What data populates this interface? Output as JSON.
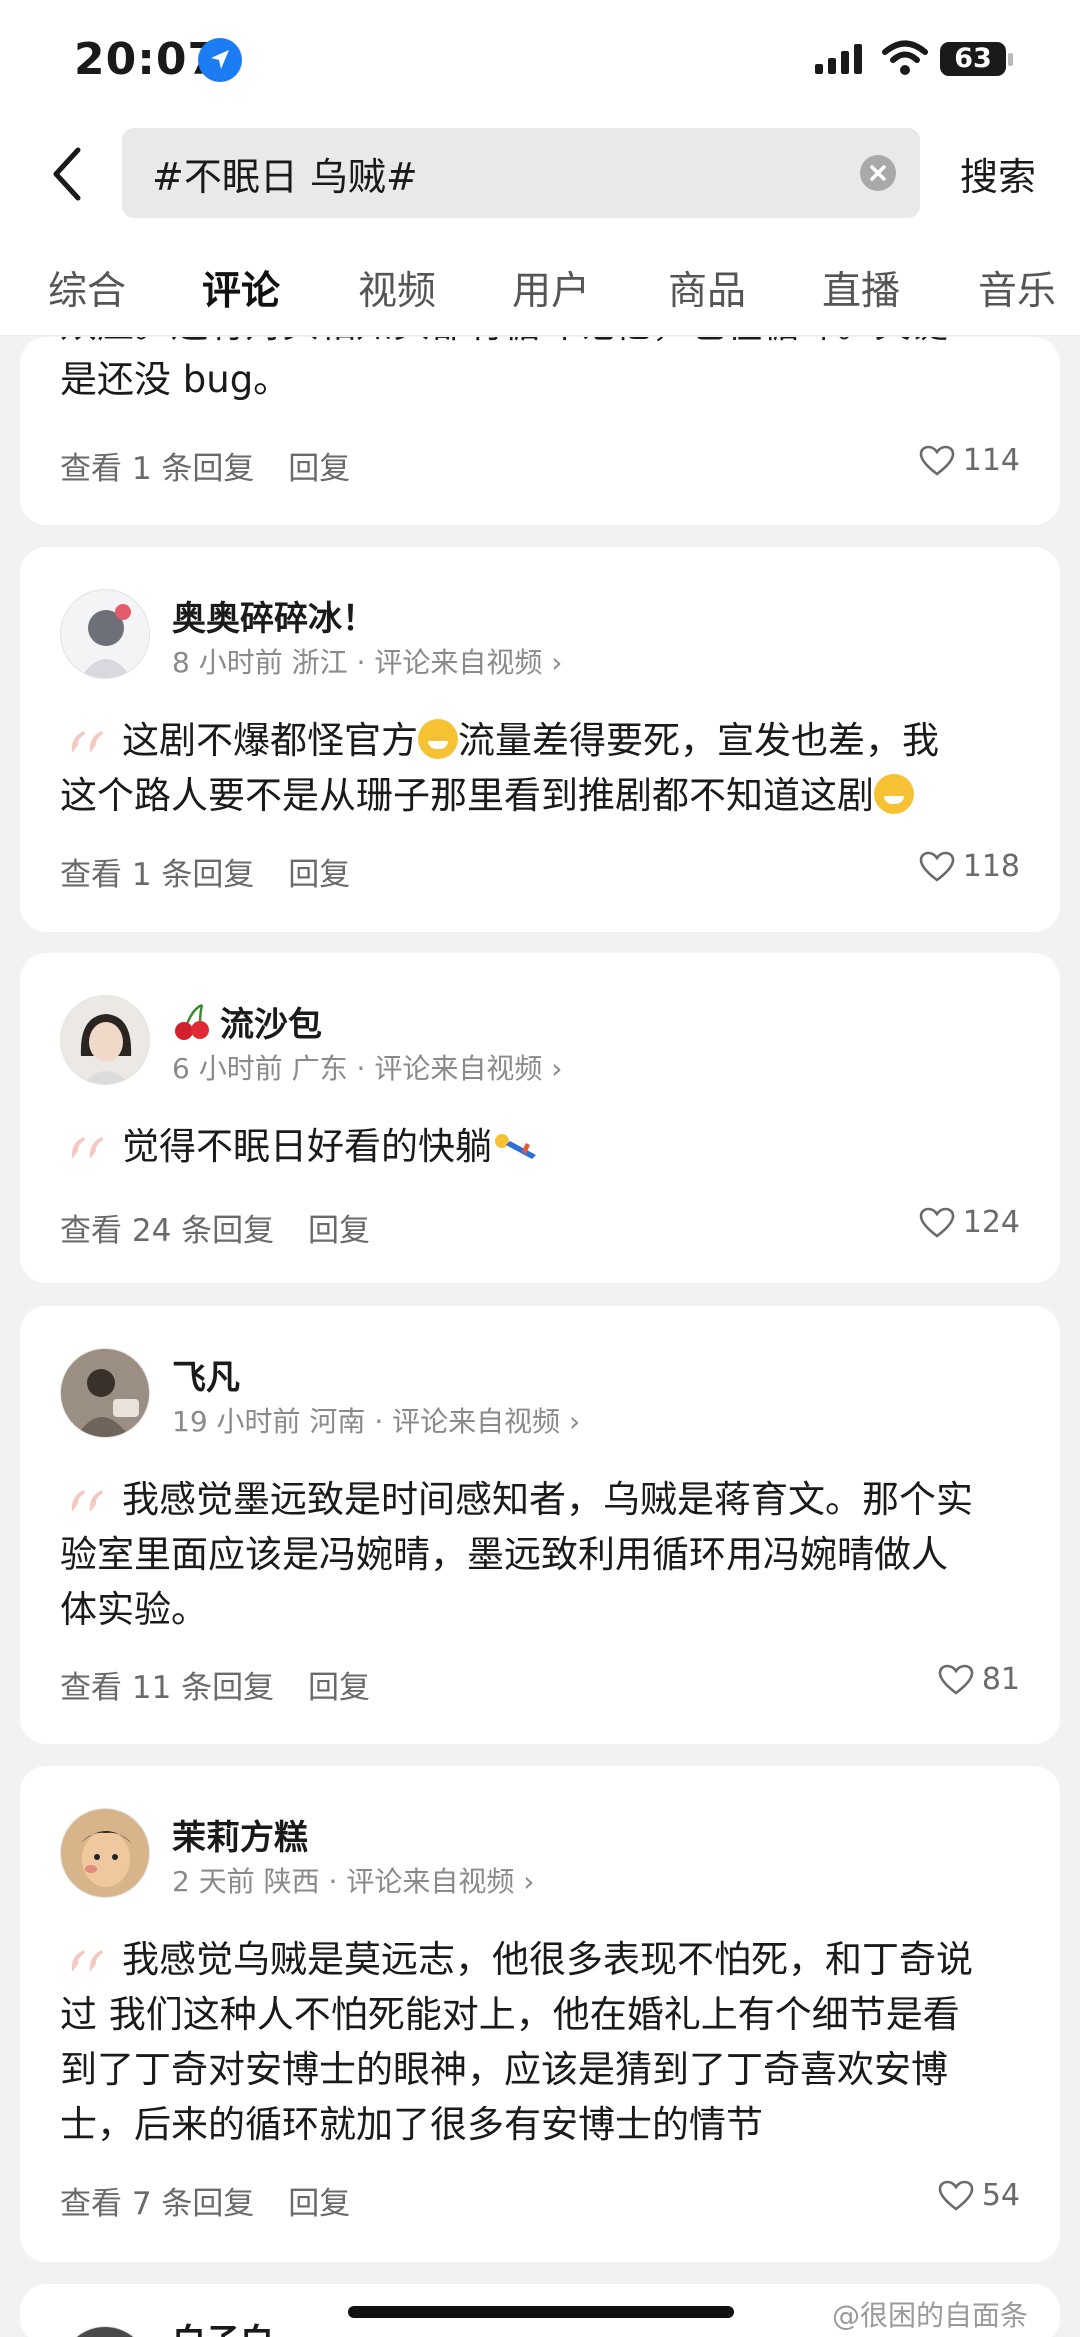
{
  "status": {
    "time": "20:07",
    "battery": "63"
  },
  "search": {
    "query": "#不眠日 乌贼#",
    "button": "搜索"
  },
  "tabs": [
    "综合",
    "评论",
    "视频",
    "用户",
    "商品",
    "直播",
    "音乐"
  ],
  "partial_comment": {
    "text_line1": "双应。还有对头相知头都有循环记忆，也在循环。关键",
    "text_line2": "是还没 bug。",
    "view_replies": "查看 1 条回复",
    "reply": "回复",
    "likes": "114"
  },
  "comments": [
    {
      "username": "奥奥碎碎冰！",
      "meta": "8 小时前 浙江 · 评论来自视频",
      "text_a": "这剧不爆都怪官方",
      "text_b": "流量差得要死，宣发也差，我",
      "text_c": "这个路人要不是从珊子那里看到推剧都不知道这剧",
      "view_replies": "查看 1 条回复",
      "reply": "回复",
      "likes": "118"
    },
    {
      "username": "流沙包",
      "username_prefix_icon": "cherry-emoji",
      "meta": "6 小时前 广东 · 评论来自视频",
      "text_a": "觉得不眠日好看的快躺",
      "view_replies": "查看 24 条回复",
      "reply": "回复",
      "likes": "124"
    },
    {
      "username": "飞凡",
      "meta": "19 小时前 河南 · 评论来自视频",
      "text_a": "我感觉墨远致是时间感知者，乌贼是蒋育文。那个实",
      "text_b": "验室里面应该是冯婉晴，墨远致利用循环用冯婉晴做人",
      "text_c": "体实验。",
      "view_replies": "查看 11 条回复",
      "reply": "回复",
      "likes": "81"
    },
    {
      "username": "茉莉方糕",
      "meta": "2 天前 陕西 · 评论来自视频",
      "text_a": "我感觉乌贼是莫远志，他很多表现不怕死，和丁奇说",
      "text_b": "过 我们这种人不怕死能对上，他在婚礼上有个细节是看",
      "text_c": "到了丁奇对安博士的眼神，应该是猜到了丁奇喜欢安博",
      "text_d": "士，后来的循环就加了很多有安博士的情节",
      "view_replies": "查看 7 条回复",
      "reply": "回复",
      "likes": "54"
    },
    {
      "username": "白子白"
    }
  ],
  "watermark": "@很困的自面条",
  "colors": {
    "accent": "#1c7cf3",
    "background": "#f2f2f2",
    "card": "#ffffff",
    "quote": "#f3c9c0"
  }
}
